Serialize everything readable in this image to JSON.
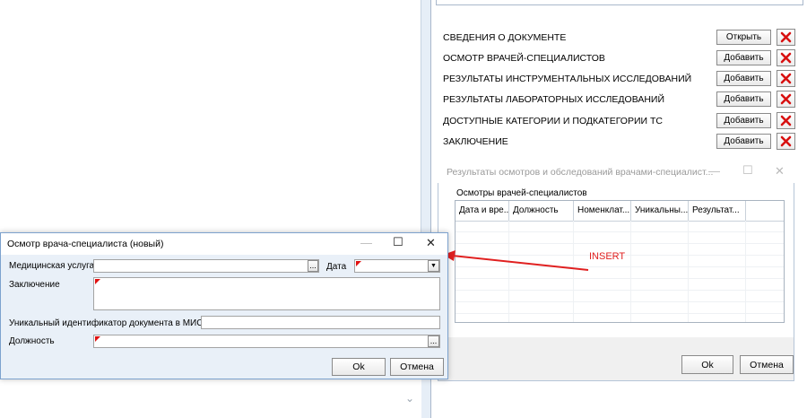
{
  "right_panel": {
    "sections": [
      {
        "label": "СВЕДЕНИЯ О ДОКУМЕНТЕ",
        "button": "Открыть"
      },
      {
        "label": "ОСМОТР ВРАЧЕЙ-СПЕЦИАЛИСТОВ",
        "button": "Добавить"
      },
      {
        "label": "РЕЗУЛЬТАТЫ ИНСТРУМЕНТАЛЬНЫХ ИССЛЕДОВАНИЙ",
        "button": "Добавить"
      },
      {
        "label": "РЕЗУЛЬТАТЫ ЛАБОРАТОРНЫХ ИССЛЕДОВАНИЙ",
        "button": "Добавить"
      },
      {
        "label": "ДОСТУПНЫЕ КАТЕГОРИИ И ПОДКАТЕГОРИИ ТС",
        "button": "Добавить"
      },
      {
        "label": "ЗАКЛЮЧЕНИЕ",
        "button": "Добавить"
      }
    ]
  },
  "results_dialog": {
    "title": "Результаты осмотров и обследований врачами-специалист...",
    "grid_label": "Осмотры врачей-специалистов",
    "columns": [
      "Дата и вре...",
      "Должность",
      "Номенклат...",
      "Уникальны...",
      "Результат..."
    ],
    "ok": "Ok",
    "cancel": "Отмена"
  },
  "exam_dialog": {
    "title": "Осмотр врача-специалиста (новый)",
    "service_label": "Медицинская услуга",
    "date_label": "Дата",
    "conclusion_label": "Заключение",
    "uid_label": "Уникальный идентификатор документа в МИС",
    "position_label": "Должность",
    "ok": "Ok",
    "cancel": "Отмена"
  },
  "annotation": {
    "text": "INSERT",
    "color": "#e02020"
  },
  "glyphs": {
    "minimize": "—",
    "maximize": "☐",
    "close": "✕",
    "dots": "...",
    "dropdown": "▼",
    "chevron": "⌄",
    "delete_icon": "red-x-icon"
  }
}
